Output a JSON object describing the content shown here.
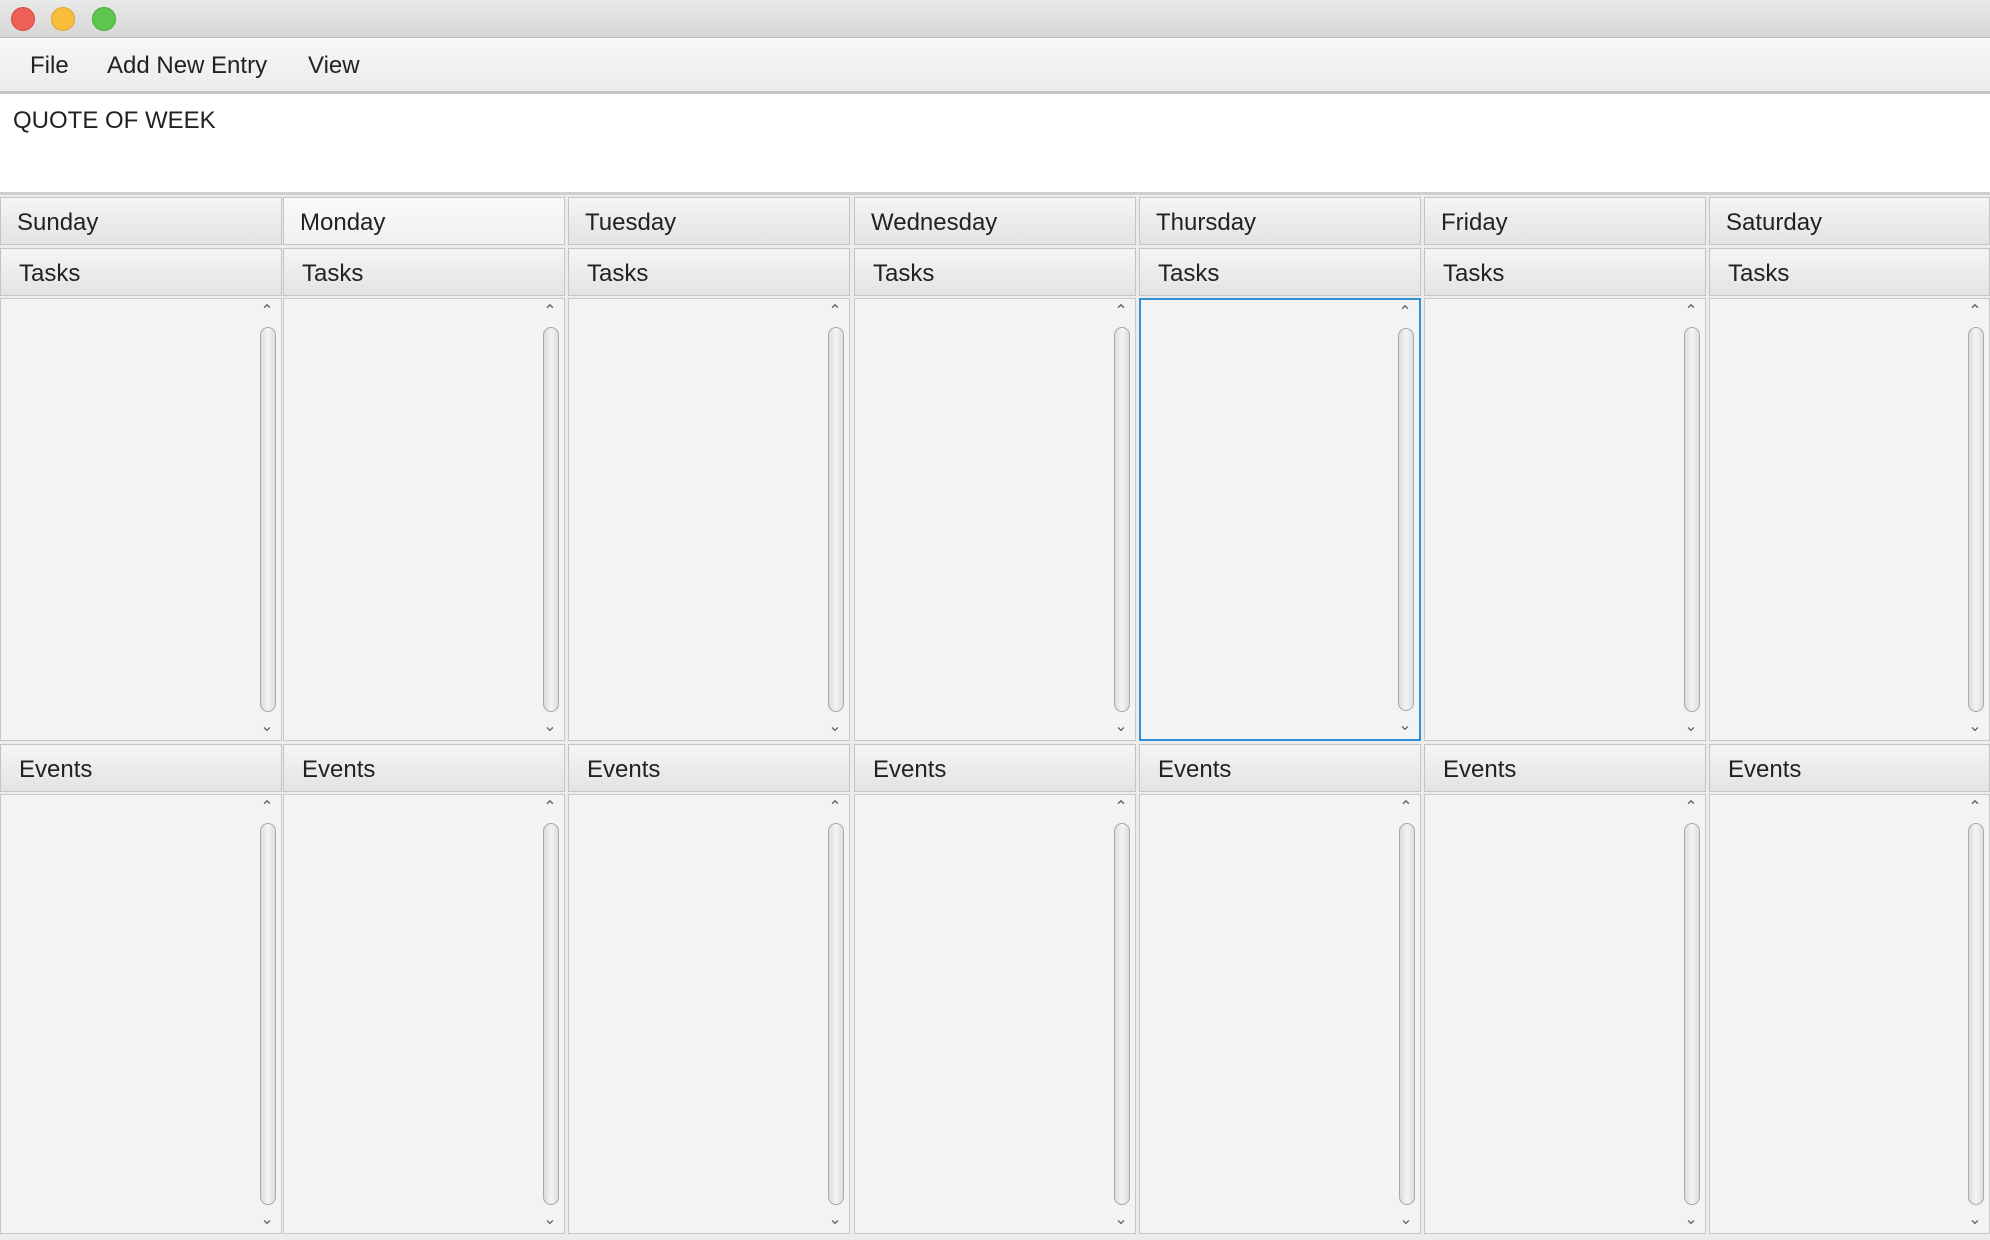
{
  "window": {
    "controls": [
      "close",
      "minimize",
      "maximize"
    ]
  },
  "menu": {
    "file": "File",
    "add_new_entry": "Add New Entry",
    "view": "View"
  },
  "quote": {
    "label": "QUOTE OF WEEK"
  },
  "days": [
    {
      "name": "Sunday",
      "tasks_label": "Tasks",
      "events_label": "Events"
    },
    {
      "name": "Monday",
      "tasks_label": "Tasks",
      "events_label": "Events"
    },
    {
      "name": "Tuesday",
      "tasks_label": "Tasks",
      "events_label": "Events"
    },
    {
      "name": "Wednesday",
      "tasks_label": "Tasks",
      "events_label": "Events"
    },
    {
      "name": "Thursday",
      "tasks_label": "Tasks",
      "events_label": "Events"
    },
    {
      "name": "Friday",
      "tasks_label": "Tasks",
      "events_label": "Events"
    },
    {
      "name": "Saturday",
      "tasks_label": "Tasks",
      "events_label": "Events"
    }
  ],
  "selected_day_tab": "Monday",
  "focused_list": "Thursday tasks",
  "icons": {
    "scroll_up": "chevron-up-icon",
    "scroll_down": "chevron-down-icon"
  },
  "colors": {
    "focus": "#2f8fd8",
    "close": "#ee5f58",
    "minimize": "#f8be3b",
    "maximize": "#5fc64f"
  }
}
